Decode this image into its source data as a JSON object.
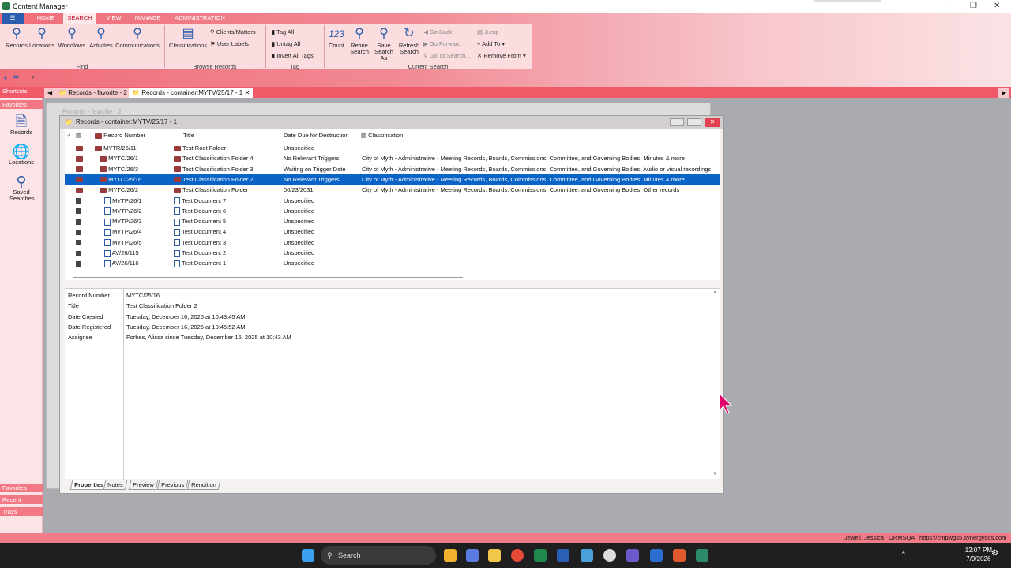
{
  "window": {
    "title": "Content Manager"
  },
  "ribbon": {
    "tabs": [
      "HOME",
      "SEARCH",
      "VIEW",
      "MANAGE",
      "ADMINISTRATION"
    ],
    "active_tab": "SEARCH",
    "find": {
      "label": "Find",
      "buttons": [
        "Records",
        "Locations",
        "Workflows",
        "Activities",
        "Communications"
      ]
    },
    "browse": {
      "label": "Browse Records",
      "classifications": "Classifications",
      "clients": "Clients/Matters",
      "user_labels": "User Labels"
    },
    "tag": {
      "label": "Tag",
      "tag_all": "Tag All",
      "untag_all": "Untag All",
      "invert": "Invert All Tags"
    },
    "current": {
      "label": "Current Search",
      "count_value": "123",
      "count": "Count",
      "refine": "Refine Search",
      "save_as": "Save Search As",
      "refresh": "Refresh Search",
      "go_back": "Go Back",
      "go_forward": "Go Forward",
      "go_to": "Go To Search...",
      "jump": "Jump",
      "add_to": "Add To",
      "remove_from": "Remove From"
    }
  },
  "doc_tabs": [
    "Records - favorite - 2",
    "Records - container:MYTV/25/17 - 1"
  ],
  "sidebar": {
    "shortcuts": "Shortcuts",
    "favorites": "Favorites",
    "items": [
      "Records",
      "Locations",
      "Saved Searches"
    ],
    "bottom": [
      "Favorites",
      "Recent",
      "Trays"
    ]
  },
  "bg_window": {
    "title": "Records - favorite - 2"
  },
  "main_window": {
    "title": "Records - container:MYTV/25/17 - 1",
    "columns": [
      "Record Number",
      "Title",
      "Date Due for Destruction",
      "Classification"
    ],
    "rows": [
      {
        "num": "MYTR/25/11",
        "title": "Test Root Folder",
        "due": "Unspecified",
        "class": "",
        "type": "folder"
      },
      {
        "num": "MYTC/26/1",
        "title": "Test Classification Folder 4",
        "due": "No Relevant Triggers",
        "class": "City of Myth - Administrative - Meeting Records, Boards, Commissions, Committee, and Governing Bodies: Minutes & more",
        "type": "folder"
      },
      {
        "num": "MYTC/26/3",
        "title": "Test Classification Folder 3",
        "due": "Waiting on Trigger Date",
        "class": "City of Myth - Administrative - Meeting Records, Boards, Commissions, Committee, and Governing Bodies: Audio or visual recordings",
        "type": "folder"
      },
      {
        "num": "MYTC/25/16",
        "title": "Test Classification Folder 2",
        "due": "No Relevant Triggers",
        "class": "City of Myth - Administrative - Meeting Records, Boards, Commissions, Committee, and Governing Bodies: Minutes & more",
        "type": "folder",
        "selected": true
      },
      {
        "num": "MYTC/26/2",
        "title": "Test Classification Folder",
        "due": "06/23/2031",
        "class": "City of Myth - Administrative - Meeting Records, Boards, Commissions, Committee, and Governing Bodies: Other records",
        "type": "folder"
      },
      {
        "num": "MYTP/26/1",
        "title": "Test Document 7",
        "due": "Unspecified",
        "class": "",
        "type": "doc"
      },
      {
        "num": "MYTP/26/2",
        "title": "Test Document 6",
        "due": "Unspecified",
        "class": "",
        "type": "doc"
      },
      {
        "num": "MYTP/26/3",
        "title": "Test Document 5",
        "due": "Unspecified",
        "class": "",
        "type": "doc"
      },
      {
        "num": "MYTP/26/4",
        "title": "Test Document 4",
        "due": "Unspecified",
        "class": "",
        "type": "doc"
      },
      {
        "num": "MYTP/26/5",
        "title": "Test Document 3",
        "due": "Unspecified",
        "class": "",
        "type": "doc"
      },
      {
        "num": "AV/26/115",
        "title": "Test Document 2",
        "due": "Unspecified",
        "class": "",
        "type": "doc"
      },
      {
        "num": "AV/26/116",
        "title": "Test Document 1",
        "due": "Unspecified",
        "class": "",
        "type": "doc"
      }
    ],
    "properties": [
      {
        "label": "Record Number",
        "value": "MYTC/25/16"
      },
      {
        "label": "Title",
        "value": "Test Classification Folder 2"
      },
      {
        "label": "Date Created",
        "value": "Tuesday, December 16, 2025 at 10:43:45 AM"
      },
      {
        "label": "Date Registered",
        "value": "Tuesday, December 16, 2025 at 10:45:52 AM"
      },
      {
        "label": "Assignee",
        "value": "Forbes, Alissa since Tuesday, December 16, 2025 at 10:43 AM"
      }
    ],
    "bottom_tabs": [
      "Properties",
      "Notes",
      "Preview",
      "Previous",
      "Rendition"
    ]
  },
  "status": {
    "user": "Jewell, Jessica",
    "db": "ORMSQA",
    "url": "https://cmpwgs5.synergydcs.com"
  },
  "taskbar": {
    "search": "Search",
    "time": "12:07 PM",
    "date": "7/9/2026"
  },
  "colors": {
    "accent": "#f05a68",
    "selection": "#0a64c8"
  }
}
